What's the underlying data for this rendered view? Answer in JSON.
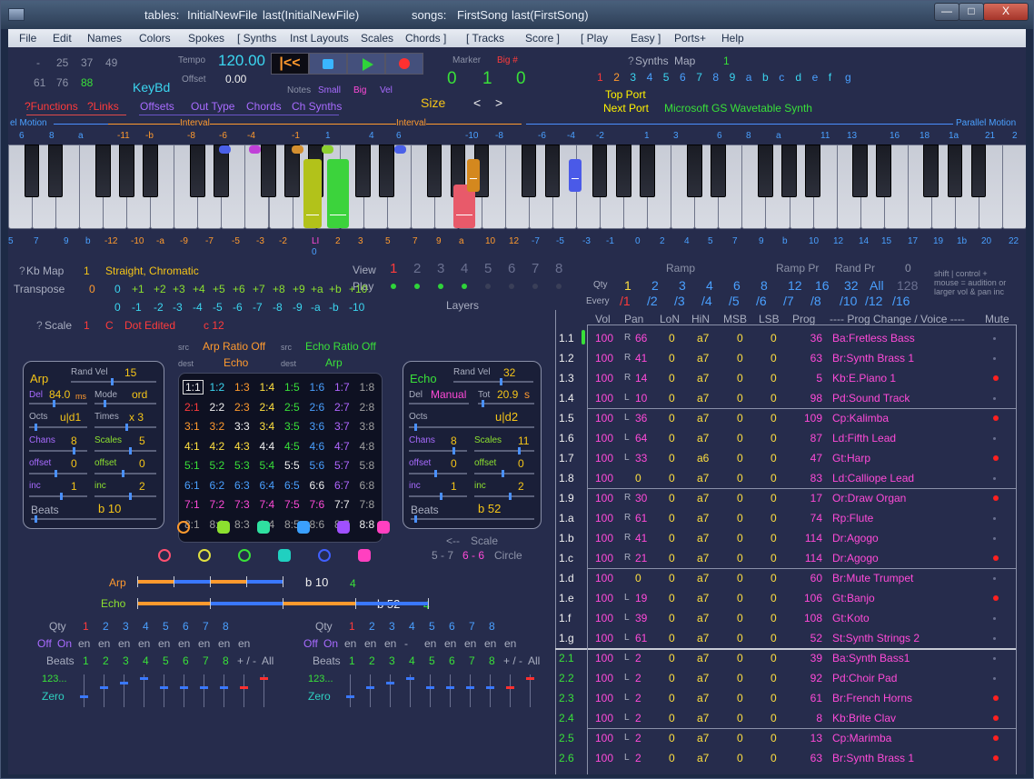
{
  "titlebar": {
    "tables_label": "tables:",
    "table_name": "InitialNewFile",
    "last_table": "last(InitialNewFile)",
    "songs_label": "songs:",
    "song_name": "FirstSong",
    "last_song": "last(FirstSong)"
  },
  "window_buttons": {
    "minimize": "—",
    "maximize": "□",
    "close": "X"
  },
  "menu": [
    "File",
    "Edit",
    "Names",
    "Colors",
    "Spokes",
    "[  Synths",
    "Inst Layouts",
    "Scales",
    "Chords  ]",
    "[  Tracks",
    "Score  ]",
    "[  Play",
    "Easy  ]",
    "Ports+",
    "Help"
  ],
  "topleft": {
    "n1": "-",
    "n2": "25",
    "n3": "37",
    "n4": "49",
    "n5": "61",
    "n6": "76",
    "n7": "88",
    "keybd": "KeyBd",
    "functions": "?Functions",
    "links": "?Links",
    "offsets": "Offsets",
    "outtype": "Out Type",
    "chords": "Chords",
    "chsynths": "Ch Synths"
  },
  "transport": {
    "tempo_label": "Tempo",
    "tempo": "120.00",
    "offset_label": "Offset",
    "offset": "0.00",
    "notes_label": "Notes",
    "small": "Small",
    "big": "Big",
    "vel": "Vel",
    "size": "Size",
    "left_arrow": "<",
    "right_arrow": ">",
    "marker_label": "Marker",
    "bignum_label": "Big #",
    "v0": "0",
    "v1": "1",
    "v2": "0"
  },
  "synths": {
    "q": "?",
    "label": "Synths",
    "map": "Map",
    "map_val": "1",
    "channels": [
      "1",
      "2",
      "3",
      "4",
      "5",
      "6",
      "7",
      "8",
      "9",
      "a",
      "b",
      "c",
      "d",
      "e",
      "f",
      "g"
    ],
    "top_port": "Top Port",
    "next_port": "Next Port",
    "synth_name": "Microsoft GS Wavetable Synth"
  },
  "intervals": {
    "left": "el Motion",
    "right": "Parallel Motion",
    "interval": "Interval",
    "top_labels": [
      "6",
      "8",
      "a",
      "-11",
      "-b",
      "-8",
      "-6",
      "-4",
      "-1",
      "1",
      "4",
      "6",
      "-10",
      "-8",
      "-6",
      "-4",
      "-2",
      "1",
      "3",
      "6",
      "8",
      "a",
      "11",
      "13",
      "16",
      "18",
      "1a",
      "21",
      "2"
    ],
    "bottom_labels": [
      "5",
      "7",
      "9",
      "b",
      "-12",
      "-10",
      "-a",
      "-9",
      "-7",
      "-5",
      "-3",
      "-2",
      "LI",
      "2",
      "3",
      "5",
      "7",
      "9",
      "a",
      "10",
      "12",
      "-7",
      "-5",
      "-3",
      "-1",
      "0",
      "2",
      "4",
      "5",
      "7",
      "9",
      "b",
      "10",
      "12",
      "14",
      "15",
      "17",
      "19",
      "1b",
      "20",
      "22"
    ],
    "li_sub": "0"
  },
  "kbmap": {
    "q": "?",
    "label": "Kb Map",
    "num": "1",
    "mode": "Straight, Chromatic",
    "transpose_label": "Transpose",
    "transpose": "0",
    "row1": [
      "0",
      "+1",
      "+2",
      "+3",
      "+4",
      "+5",
      "+6",
      "+7",
      "+8",
      "+9",
      "+a",
      "+b",
      "+10"
    ],
    "row2": [
      "0",
      "-1",
      "-2",
      "-3",
      "-4",
      "-5",
      "-6",
      "-7",
      "-8",
      "-9",
      "-a",
      "-b",
      "-10"
    ]
  },
  "view": {
    "view_label": "View",
    "play_label": "Play",
    "layers": "Layers",
    "nums": [
      "1",
      "2",
      "3",
      "4",
      "5",
      "6",
      "7",
      "8"
    ]
  },
  "scale": {
    "q": "?",
    "label": "Scale",
    "num": "1",
    "key": "C",
    "edited": "Dot Edited",
    "c": "c 12"
  },
  "ratio": {
    "src1": "src",
    "arp_ratio": "Arp Ratio Off",
    "dest1": "dest",
    "echo1": "Echo",
    "src2": "src",
    "echo_ratio": "Echo Ratio Off",
    "dest2": "dest",
    "arp1": "Arp"
  },
  "arp": {
    "title": "Arp",
    "randvel_label": "Rand Vel",
    "randvel": "15",
    "del_label": "Del",
    "del": "84.0",
    "ms": "ms",
    "mode_label": "Mode",
    "mode": "ord",
    "octs_label": "Octs",
    "octs": "u|d1",
    "times_label": "Times",
    "times": "x 3",
    "chans_label": "Chans",
    "chans": "8",
    "scales_label": "Scales",
    "scales": "5",
    "offset_label": "offset",
    "offset": "0",
    "offset2_label": "offset",
    "offset2": "0",
    "inc_label": "inc",
    "inc": "1",
    "inc2_label": "inc",
    "inc2": "2",
    "beats_label": "Beats",
    "beats": "b 10"
  },
  "echo": {
    "title": "Echo",
    "randvel_label": "Rand Vel",
    "randvel": "32",
    "del_label": "Del",
    "del": "Manual",
    "tot_label": "Tot",
    "tot": "20.9",
    "s": "s",
    "octs_label": "Octs",
    "octs": "u|d2",
    "chans_label": "Chans",
    "chans": "8",
    "scales_label": "Scales",
    "scales": "11",
    "offset_label": "offset",
    "offset": "0",
    "offset2_label": "offset",
    "offset2": "0",
    "inc_label": "inc",
    "inc": "1",
    "inc2_label": "inc",
    "inc2": "2",
    "beats_label": "Beats",
    "beats": "b 52"
  },
  "ratio_grid": [
    "1:1",
    "1:2",
    "1:3",
    "1:4",
    "1:5",
    "1:6",
    "1:7",
    "1:8",
    "2:1",
    "2:2",
    "2:3",
    "2:4",
    "2:5",
    "2:6",
    "2:7",
    "2:8",
    "3:1",
    "3:2",
    "3:3",
    "3:4",
    "3:5",
    "3:6",
    "3:7",
    "3:8",
    "4:1",
    "4:2",
    "4:3",
    "4:4",
    "4:5",
    "4:6",
    "4:7",
    "4:8",
    "5:1",
    "5:2",
    "5:3",
    "5:4",
    "5:5",
    "5:6",
    "5:7",
    "5:8",
    "6:1",
    "6:2",
    "6:3",
    "6:4",
    "6:5",
    "6:6",
    "6:7",
    "6:8",
    "7:1",
    "7:2",
    "7:3",
    "7:4",
    "7:5",
    "7:6",
    "7:7",
    "7:8",
    "8:1",
    "8:2",
    "8:3",
    "8:4",
    "8:5",
    "8:6",
    "8:7",
    "8:8"
  ],
  "scale_circle": {
    "arrow": "<--",
    "label": "Scale",
    "a": "5 - 7",
    "b": "6 - 6",
    "c": "Circle"
  },
  "bars": {
    "arp_label": "Arp",
    "arp_beats": "b 10",
    "arp_n": "4",
    "echo_label": "Echo",
    "echo_beats": "b 52",
    "echo_n": "4"
  },
  "qty_left": {
    "qty": "Qty",
    "nums": [
      "1",
      "2",
      "3",
      "4",
      "5",
      "6",
      "7",
      "8"
    ],
    "off": "Off",
    "on": "On",
    "en": [
      "en",
      "en",
      "en",
      "en",
      "en",
      "en",
      "en",
      "en",
      "en"
    ],
    "beats": "Beats",
    "bnums": [
      "1",
      "2",
      "3",
      "4",
      "5",
      "6",
      "7",
      "8"
    ],
    "pm": "+ / -",
    "all": "All",
    "s123": "123...",
    "zero": "Zero"
  },
  "qty_right": {
    "qty": "Qty",
    "nums": [
      "1",
      "2",
      "3",
      "4",
      "5",
      "6",
      "7",
      "8"
    ],
    "off": "Off",
    "on": "On",
    "en": [
      "en",
      "en",
      "en",
      "-",
      "en",
      "en",
      "en",
      "en",
      "en"
    ],
    "beats": "Beats",
    "bnums": [
      "1",
      "2",
      "3",
      "4",
      "5",
      "6",
      "7",
      "8"
    ],
    "pm": "+ / -",
    "all": "All",
    "s123": "123...",
    "zero": "Zero"
  },
  "ramp": {
    "ramp": "Ramp",
    "ramp_pr": "Ramp Pr",
    "rand_pr": "Rand Pr",
    "rand_val": "0",
    "qty": "Qty",
    "every": "Every",
    "qty_vals": [
      "1",
      "2",
      "3",
      "4",
      "6",
      "8",
      "12",
      "16",
      "32",
      "All",
      "128"
    ],
    "every_vals": [
      "/1",
      "/2",
      "/3",
      "/4",
      "/5",
      "/6",
      "/7",
      "/8",
      "/10",
      "/12",
      "/16"
    ],
    "hint1": "shift | control  +",
    "hint2": "mouse = audition or",
    "hint3": "larger vol & pan inc"
  },
  "mixer_headers": {
    "vol": "Vol",
    "pan": "Pan",
    "lon": "LoN",
    "hin": "HiN",
    "msb": "MSB",
    "lsb": "LSB",
    "prog": "Prog",
    "voice": "---- Prog Change / Voice ----",
    "mute": "Mute"
  },
  "mixer": [
    {
      "ch": "1.1",
      "vol": "100",
      "lr": "R",
      "pan": "66",
      "lon": "0",
      "hin": "a7",
      "msb": "0",
      "lsb": "0",
      "prog": "36",
      "voice": "Ba:Fretless Bass",
      "mute": "off"
    },
    {
      "ch": "1.2",
      "vol": "100",
      "lr": "R",
      "pan": "41",
      "lon": "0",
      "hin": "a7",
      "msb": "0",
      "lsb": "0",
      "prog": "63",
      "voice": "Br:Synth Brass 1",
      "mute": "off"
    },
    {
      "ch": "1.3",
      "vol": "100",
      "lr": "R",
      "pan": "14",
      "lon": "0",
      "hin": "a7",
      "msb": "0",
      "lsb": "0",
      "prog": "5",
      "voice": "Kb:E.Piano 1",
      "mute": "on"
    },
    {
      "ch": "1.4",
      "vol": "100",
      "lr": "L",
      "pan": "10",
      "lon": "0",
      "hin": "a7",
      "msb": "0",
      "lsb": "0",
      "prog": "98",
      "voice": "Pd:Sound Track",
      "mute": "off"
    },
    {
      "ch": "1.5",
      "vol": "100",
      "lr": "L",
      "pan": "36",
      "lon": "0",
      "hin": "a7",
      "msb": "0",
      "lsb": "0",
      "prog": "109",
      "voice": "Cp:Kalimba",
      "mute": "on"
    },
    {
      "ch": "1.6",
      "vol": "100",
      "lr": "L",
      "pan": "64",
      "lon": "0",
      "hin": "a7",
      "msb": "0",
      "lsb": "0",
      "prog": "87",
      "voice": "Ld:Fifth Lead",
      "mute": "off"
    },
    {
      "ch": "1.7",
      "vol": "100",
      "lr": "L",
      "pan": "33",
      "lon": "0",
      "hin": "a6",
      "msb": "0",
      "lsb": "0",
      "prog": "47",
      "voice": "Gt:Harp",
      "mute": "on"
    },
    {
      "ch": "1.8",
      "vol": "100",
      "lr": "",
      "pan": "0",
      "lon": "0",
      "hin": "a7",
      "msb": "0",
      "lsb": "0",
      "prog": "83",
      "voice": "Ld:Calliope Lead",
      "mute": "off"
    },
    {
      "ch": "1.9",
      "vol": "100",
      "lr": "R",
      "pan": "30",
      "lon": "0",
      "hin": "a7",
      "msb": "0",
      "lsb": "0",
      "prog": "17",
      "voice": "Or:Draw Organ",
      "mute": "on"
    },
    {
      "ch": "1.a",
      "vol": "100",
      "lr": "R",
      "pan": "61",
      "lon": "0",
      "hin": "a7",
      "msb": "0",
      "lsb": "0",
      "prog": "74",
      "voice": "Rp:Flute",
      "mute": "off"
    },
    {
      "ch": "1.b",
      "vol": "100",
      "lr": "R",
      "pan": "41",
      "lon": "0",
      "hin": "a7",
      "msb": "0",
      "lsb": "0",
      "prog": "114",
      "voice": "Dr:Agogo",
      "mute": "off"
    },
    {
      "ch": "1.c",
      "vol": "100",
      "lr": "R",
      "pan": "21",
      "lon": "0",
      "hin": "a7",
      "msb": "0",
      "lsb": "0",
      "prog": "114",
      "voice": "Dr:Agogo",
      "mute": "on"
    },
    {
      "ch": "1.d",
      "vol": "100",
      "lr": "",
      "pan": "0",
      "lon": "0",
      "hin": "a7",
      "msb": "0",
      "lsb": "0",
      "prog": "60",
      "voice": "Br:Mute Trumpet",
      "mute": "off"
    },
    {
      "ch": "1.e",
      "vol": "100",
      "lr": "L",
      "pan": "19",
      "lon": "0",
      "hin": "a7",
      "msb": "0",
      "lsb": "0",
      "prog": "106",
      "voice": "Gt:Banjo",
      "mute": "on"
    },
    {
      "ch": "1.f",
      "vol": "100",
      "lr": "L",
      "pan": "39",
      "lon": "0",
      "hin": "a7",
      "msb": "0",
      "lsb": "0",
      "prog": "108",
      "voice": "Gt:Koto",
      "mute": "off"
    },
    {
      "ch": "1.g",
      "vol": "100",
      "lr": "L",
      "pan": "61",
      "lon": "0",
      "hin": "a7",
      "msb": "0",
      "lsb": "0",
      "prog": "52",
      "voice": "St:Synth Strings 2",
      "mute": "off"
    },
    {
      "ch": "2.1",
      "vol": "100",
      "lr": "L",
      "pan": "2",
      "lon": "0",
      "hin": "a7",
      "msb": "0",
      "lsb": "0",
      "prog": "39",
      "voice": "Ba:Synth Bass1",
      "mute": "off"
    },
    {
      "ch": "2.2",
      "vol": "100",
      "lr": "L",
      "pan": "2",
      "lon": "0",
      "hin": "a7",
      "msb": "0",
      "lsb": "0",
      "prog": "92",
      "voice": "Pd:Choir Pad",
      "mute": "off"
    },
    {
      "ch": "2.3",
      "vol": "100",
      "lr": "L",
      "pan": "2",
      "lon": "0",
      "hin": "a7",
      "msb": "0",
      "lsb": "0",
      "prog": "61",
      "voice": "Br:French Horns",
      "mute": "on"
    },
    {
      "ch": "2.4",
      "vol": "100",
      "lr": "L",
      "pan": "2",
      "lon": "0",
      "hin": "a7",
      "msb": "0",
      "lsb": "0",
      "prog": "8",
      "voice": "Kb:Brite Clav",
      "mute": "on"
    },
    {
      "ch": "2.5",
      "vol": "100",
      "lr": "L",
      "pan": "2",
      "lon": "0",
      "hin": "a7",
      "msb": "0",
      "lsb": "0",
      "prog": "13",
      "voice": "Cp:Marimba",
      "mute": "on"
    },
    {
      "ch": "2.6",
      "vol": "100",
      "lr": "L",
      "pan": "2",
      "lon": "0",
      "hin": "a7",
      "msb": "0",
      "lsb": "0",
      "prog": "63",
      "voice": "Br:Synth Brass 1",
      "mute": "on"
    }
  ]
}
